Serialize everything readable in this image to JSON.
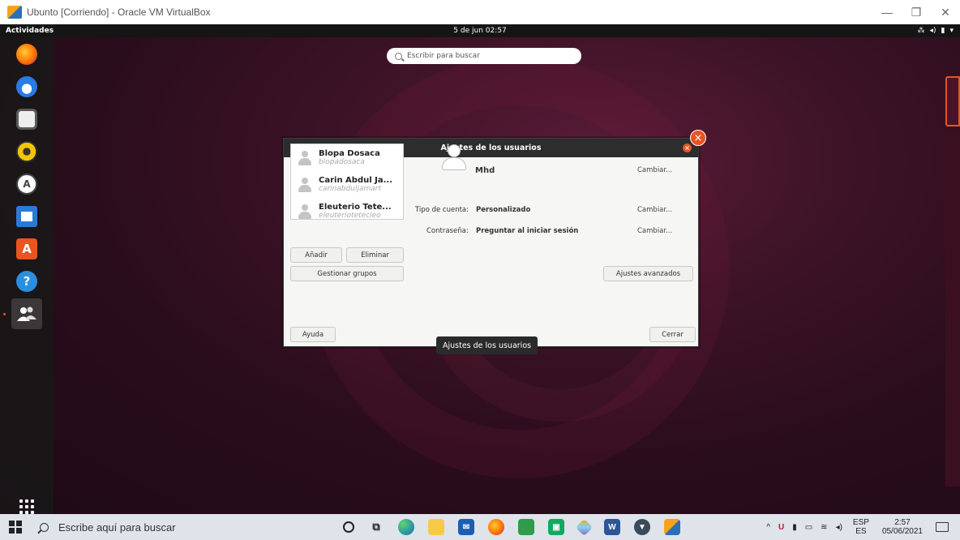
{
  "host": {
    "window_title": "Ubunto [Corriendo] - Oracle VM VirtualBox",
    "minimize": "—",
    "restore": "❐",
    "close": "✕"
  },
  "vm": {
    "topbar": {
      "activities": "Actividades",
      "clock": "5 de jun  02:57",
      "tray_network": "⁂",
      "tray_volume": "◂)",
      "tray_battery": "▮",
      "tray_menu": "▾"
    },
    "search": {
      "placeholder": "Escribir para buscar"
    },
    "dock": [
      "firefox-icon",
      "thunderbird-icon",
      "files-icon",
      "rhythmbox-icon",
      "software-center-icon",
      "writer-icon",
      "app-store-icon",
      "help-icon",
      "users-icon",
      "show-apps-icon"
    ],
    "dialog": {
      "title": "Ajustes de los usuarios",
      "users": [
        {
          "name": "Blopa Dosaca",
          "login": "blopadosaca"
        },
        {
          "name": "Carin Abdul Ja...",
          "login": "carinabduljamart"
        },
        {
          "name": "Eleuterio Tete...",
          "login": "eleuteriotetecleo"
        }
      ],
      "add_label": "Añadir",
      "remove_label": "Eliminar",
      "manage_groups_label": "Gestionar grupos",
      "selected_user": "Mhd",
      "account_type_label": "Tipo de cuenta:",
      "account_type_value": "Personalizado",
      "password_label": "Contraseña:",
      "password_value": "Preguntar al iniciar sesión",
      "change_name": "Cambiar...",
      "change_type": "Cambiar...",
      "change_password": "Cambiar...",
      "advanced_label": "Ajustes avanzados",
      "help_label": "Ayuda",
      "close_label": "Cerrar"
    },
    "tooltip": "Ajustes de los usuarios"
  },
  "taskbar": {
    "search_placeholder": "Escribe aquí para buscar",
    "apps": [
      "cortana-icon",
      "task-view-icon",
      "edge-icon",
      "file-explorer-icon",
      "mail-icon",
      "firefox-icon",
      "photos-icon",
      "app-icon",
      "app-icon-2",
      "word-icon",
      "vpn-icon",
      "virtualbox-icon"
    ],
    "lang_top": "ESP",
    "lang_bottom": "ES",
    "time": "2:57",
    "date": "05/06/2021"
  },
  "colors": {
    "ubuntu_orange": "#e95420",
    "dialog_title_bg": "#2d2d2d",
    "taskbar_bg": "#dfe3ea"
  }
}
